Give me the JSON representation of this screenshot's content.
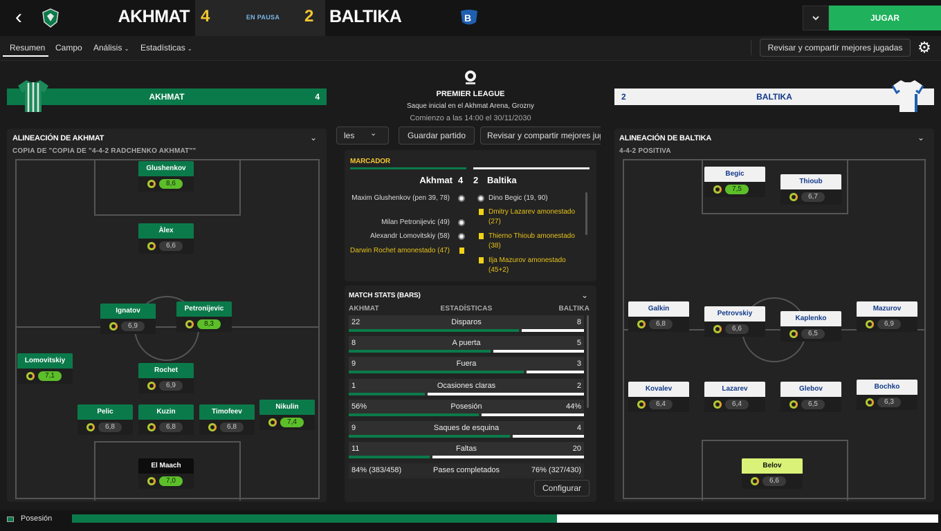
{
  "header": {
    "home_team": "AKHMAT",
    "away_team": "BALTIKA",
    "home_score": "4",
    "away_score": "2",
    "status": "EN PAUSA",
    "play_label": "JUGAR"
  },
  "nav": {
    "tabs": [
      "Resumen",
      "Campo",
      "Análisis",
      "Estadísticas"
    ],
    "review_label": "Revisar y compartir mejores jugadas"
  },
  "home": {
    "banner_name": "AKHMAT",
    "banner_score": "4",
    "lineup_title": "ALINEACIÓN DE AKHMAT",
    "formation": "COPIA DE \"COPIA DE \"4-4-2 RADCHENKO AKHMAT\"\"",
    "players": [
      {
        "name": "Glushenkov",
        "rating": "8,6",
        "high": true
      },
      {
        "name": "Àlex",
        "rating": "6,6",
        "high": false
      },
      {
        "name": "Ignatov",
        "rating": "6,9",
        "high": false
      },
      {
        "name": "Petronijevic",
        "rating": "8,3",
        "high": true
      },
      {
        "name": "Lomovitskiy",
        "rating": "7,1",
        "high": true
      },
      {
        "name": "Rochet",
        "rating": "6,9",
        "high": false
      },
      {
        "name": "Pelic",
        "rating": "6,8",
        "high": false
      },
      {
        "name": "Kuzin",
        "rating": "6,8",
        "high": false
      },
      {
        "name": "Timofeev",
        "rating": "6,8",
        "high": false
      },
      {
        "name": "Nikulin",
        "rating": "7,4",
        "high": true
      },
      {
        "name": "El Maach",
        "rating": "7,0",
        "high": true
      }
    ]
  },
  "away": {
    "banner_name": "BALTIKA",
    "banner_score": "2",
    "lineup_title": "ALINEACIÓN DE BALTIKA",
    "formation": "4-4-2 POSITIVA",
    "players": [
      {
        "name": "Begic",
        "rating": "7,5",
        "high": true
      },
      {
        "name": "Thioub",
        "rating": "6,7",
        "high": false
      },
      {
        "name": "Galkin",
        "rating": "6,8",
        "high": false
      },
      {
        "name": "Petrovskiy",
        "rating": "6,6",
        "high": false
      },
      {
        "name": "Kaplenko",
        "rating": "6,5",
        "high": false
      },
      {
        "name": "Mazurov",
        "rating": "6,9",
        "high": false
      },
      {
        "name": "Kovalev",
        "rating": "6,4",
        "high": false
      },
      {
        "name": "Lazarev",
        "rating": "6,4",
        "high": false
      },
      {
        "name": "Glebov",
        "rating": "6,5",
        "high": false
      },
      {
        "name": "Bochko",
        "rating": "6,3",
        "high": false
      },
      {
        "name": "Belov",
        "rating": "6,6",
        "high": false
      }
    ]
  },
  "match": {
    "league": "PREMIER LEAGUE",
    "venue": "Saque inicial en el Akhmat Arena, Grozny",
    "kickoff": "Comienzo a las 14:00 el 30/11/2030",
    "btn_partial": "les",
    "btn_save": "Guardar partido",
    "btn_review": "Revisar y compartir mejores jugadas",
    "scoreboard_title": "MARCADOR",
    "sb_home": "Akhmat",
    "sb_home_score": "4",
    "sb_away_score": "2",
    "sb_away": "Baltika",
    "home_events": [
      {
        "text": "Maxim Glushenkov (pen 39, 78)",
        "type": "goal"
      },
      {
        "text": "Milan Petronijevic (49)",
        "type": "goal"
      },
      {
        "text": "Alexandr Lomovitskiy (58)",
        "type": "goal"
      },
      {
        "text": "Darwin Rochet amonestado (47)",
        "type": "card"
      }
    ],
    "away_events": [
      {
        "text": "Dino Begic (19, 90)",
        "type": "goal"
      },
      {
        "text": "Dmitry Lazarev amonestado (27)",
        "type": "card"
      },
      {
        "text": "Thierno Thioub amonestado (38)",
        "type": "card"
      },
      {
        "text": "Ilja Mazurov amonestado (45+2)",
        "type": "card"
      }
    ],
    "stats_title": "MATCH STATS (BARS)",
    "stats_home": "AKHMAT",
    "stats_center": "ESTADÍSTICAS",
    "stats_away": "BALTIKA",
    "stats": [
      {
        "home": "22",
        "label": "Disparos",
        "away": "8",
        "share": 0.73
      },
      {
        "home": "8",
        "label": "A puerta",
        "away": "5",
        "share": 0.61
      },
      {
        "home": "9",
        "label": "Fuera",
        "away": "3",
        "share": 0.75
      },
      {
        "home": "1",
        "label": "Ocasiones claras",
        "away": "2",
        "share": 0.33
      },
      {
        "home": "56%",
        "label": "Posesión",
        "away": "44%",
        "share": 0.56
      },
      {
        "home": "9",
        "label": "Saques de esquina",
        "away": "4",
        "share": 0.69
      },
      {
        "home": "11",
        "label": "Faltas",
        "away": "20",
        "share": 0.35
      }
    ],
    "passes_home": "84% (383/458)",
    "passes_label": "Pases completados",
    "passes_away": "76% (327/430)",
    "configure_label": "Configurar"
  },
  "possession_bar": {
    "label": "Posesión",
    "home_share": 0.56
  },
  "colors": {
    "home_green": "#0b7a4a",
    "accent_green": "#1fb15c",
    "score_yellow": "#f2c630",
    "card_yellow": "#f2d117",
    "away_blue": "#123a8a"
  }
}
